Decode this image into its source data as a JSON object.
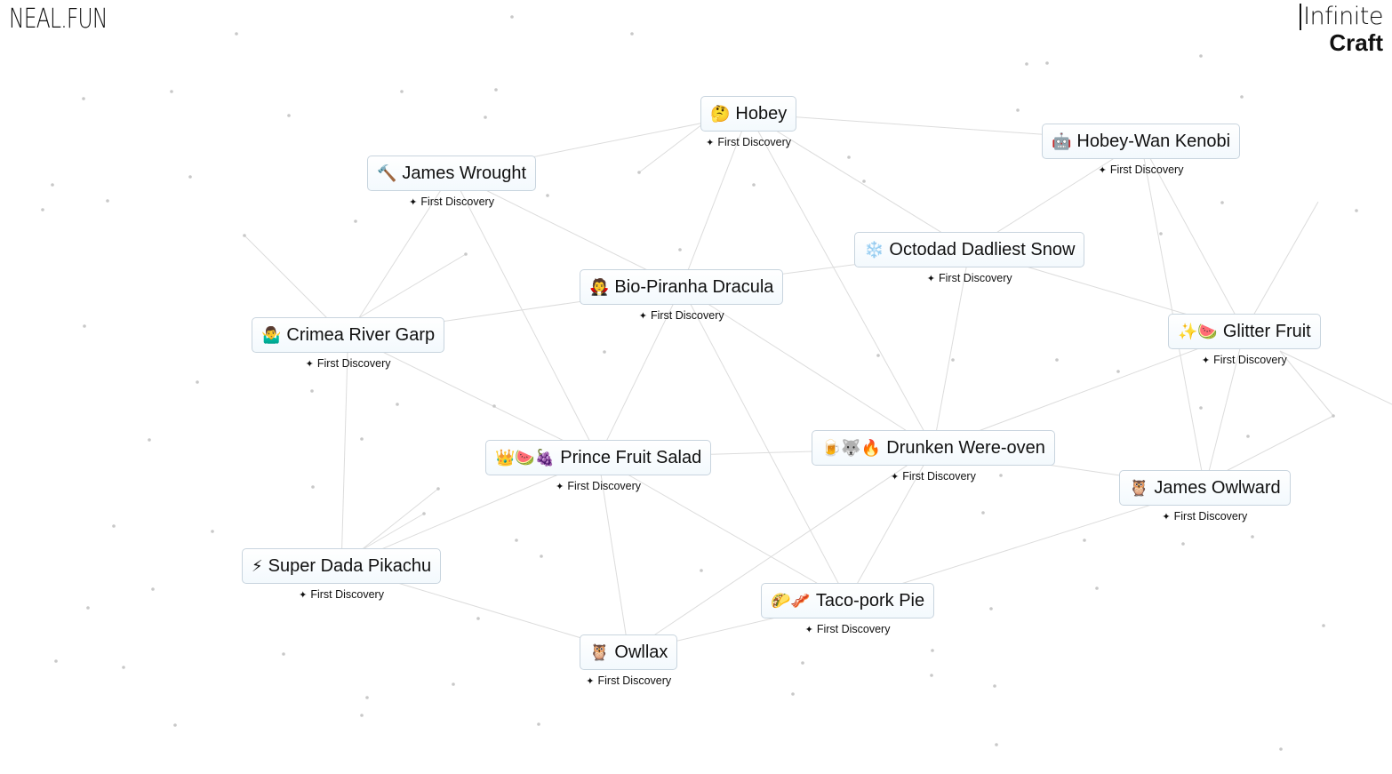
{
  "header": {
    "left_logo": "NEAL.FUN",
    "right_logo_line1": "Infinite",
    "right_logo_line2": "Craft"
  },
  "colors": {
    "background": "#ffffff",
    "item_border": "#c8d4de",
    "line": "#dcdcdc",
    "dot": "#c8c8c8"
  },
  "discovery_label": "First Discovery",
  "items": [
    {
      "id": "hobey",
      "emoji": "🤔",
      "label": "Hobey",
      "discovery": "First Discovery"
    },
    {
      "id": "james-wrought",
      "emoji": "🔨",
      "label": "James Wrought",
      "discovery": "First Discovery"
    },
    {
      "id": "hobey-wan-kenobi",
      "emoji": "🤖",
      "label": "Hobey-Wan Kenobi",
      "discovery": "First Discovery"
    },
    {
      "id": "octodad-dadliest-snow",
      "emoji": "❄️",
      "label": "Octodad Dadliest Snow",
      "discovery": "First Discovery"
    },
    {
      "id": "bio-piranha-dracula",
      "emoji": "🧛",
      "label": "Bio-Piranha Dracula",
      "discovery": "First Discovery"
    },
    {
      "id": "crimea-river-garp",
      "emoji": "🤷‍♂️",
      "label": "Crimea River Garp",
      "discovery": "First Discovery"
    },
    {
      "id": "glitter-fruit",
      "emoji": "✨🍉",
      "label": "Glitter Fruit",
      "discovery": "First Discovery"
    },
    {
      "id": "prince-fruit-salad",
      "emoji": "👑🍉🍇",
      "label": "Prince Fruit Salad",
      "discovery": "First Discovery"
    },
    {
      "id": "drunken-were-oven",
      "emoji": "🍺🐺🔥",
      "label": "Drunken Were-oven",
      "discovery": "First Discovery"
    },
    {
      "id": "james-owlward",
      "emoji": "🦉",
      "label": "James Owlward",
      "discovery": "First Discovery"
    },
    {
      "id": "super-dada-pikachu",
      "emoji": "⚡",
      "label": "Super Dada Pikachu",
      "discovery": "First Discovery"
    },
    {
      "id": "taco-pork-pie",
      "emoji": "🌮🥓",
      "label": "Taco-pork Pie",
      "discovery": "First Discovery"
    },
    {
      "id": "owllax",
      "emoji": "🦉",
      "label": "Owllax",
      "discovery": "First Discovery"
    }
  ],
  "icons": {
    "discovery": "sparkles-icon"
  }
}
